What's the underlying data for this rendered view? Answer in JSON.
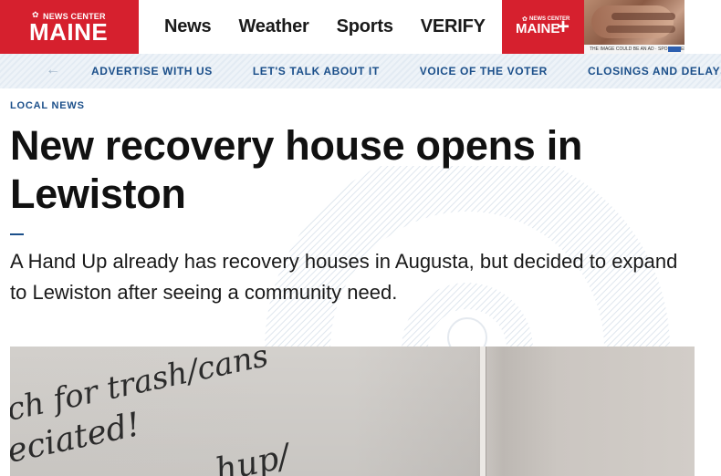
{
  "header": {
    "logo_top": "NEWS CENTER",
    "logo_main": "MAINE",
    "nav": [
      "News",
      "Weather",
      "Sports",
      "VERIFY"
    ],
    "plus_top": "NEWS CENTER",
    "plus_main": "MAINE",
    "plus_symbol": "+",
    "ad_text": "THE IMAGE COULD BE AN AD · SPONSORED"
  },
  "subnav": {
    "items": [
      "ADVERTISE WITH US",
      "LET'S TALK ABOUT IT",
      "VOICE OF THE VOTER",
      "CLOSINGS AND DELAYS"
    ]
  },
  "article": {
    "section": "LOCAL NEWS",
    "headline": "New recovery house opens in Lewiston",
    "dek": "A Hand Up already has recovery houses in Augusta, but decided to expand to Lewiston after seeing a community need."
  },
  "hero": {
    "scrawl_1": "ch for trash/cans",
    "scrawl_2": "eciated!",
    "scrawl_3": "hup/"
  },
  "colors": {
    "brand_red": "#d6202e",
    "link_blue": "#1b4f8a"
  },
  "icons": {
    "subnav_back": "arrow-left-icon",
    "logo": "peacock-icon"
  }
}
